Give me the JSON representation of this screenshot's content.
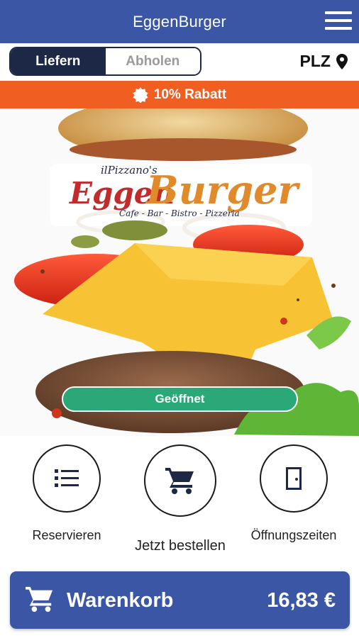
{
  "app": {
    "title": "EggenBurger"
  },
  "order_mode": {
    "options": [
      "Liefern",
      "Abholen"
    ],
    "selected": "Liefern"
  },
  "location": {
    "label": "PLZ"
  },
  "promo": {
    "text": "10% Rabatt"
  },
  "hero": {
    "logo_top": "ilPizzano's",
    "logo_word1": "Eggen",
    "logo_word2": "Burger",
    "logo_tagline": "Cafe - Bar - Bistro - Pizzeria",
    "status": "Geöffnet"
  },
  "actions": [
    {
      "label": "Reservieren",
      "icon": "list-icon"
    },
    {
      "label": "Jetzt bestellen",
      "icon": "cart-icon"
    },
    {
      "label": "Öffnungszeiten",
      "icon": "door-icon"
    }
  ],
  "cart": {
    "label": "Warenkorb",
    "total": "16,83 €"
  },
  "colors": {
    "primary": "#3a56a5",
    "dark": "#1c2846",
    "promo": "#f15e22",
    "open": "#2aa878"
  }
}
